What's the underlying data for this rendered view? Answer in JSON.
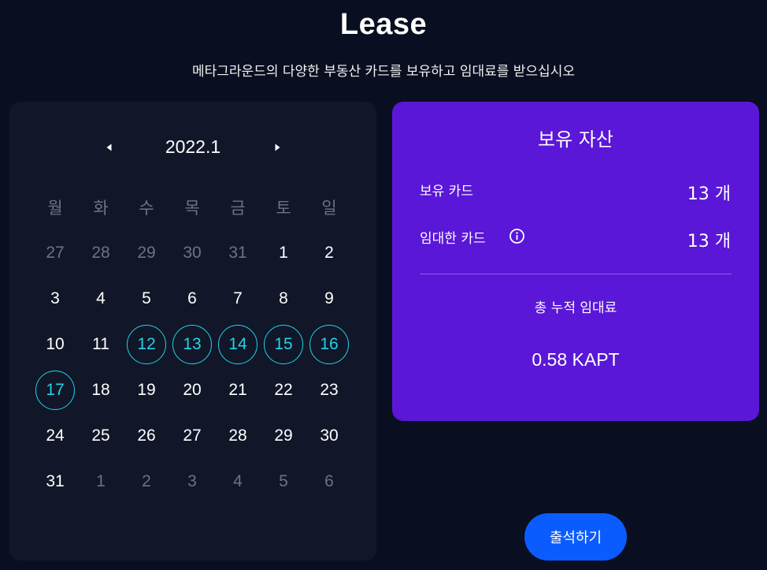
{
  "header": {
    "title": "Lease",
    "subtitle": "메타그라운드의 다양한 부동산 카드를 보유하고 임대료를 받으십시오"
  },
  "calendar": {
    "month_label": "2022.1",
    "prev_icon": "caret-left-icon",
    "next_icon": "caret-right-icon",
    "weekdays": [
      "월",
      "화",
      "수",
      "목",
      "금",
      "토",
      "일"
    ],
    "days": [
      {
        "label": "27",
        "state": "muted"
      },
      {
        "label": "28",
        "state": "muted"
      },
      {
        "label": "29",
        "state": "muted"
      },
      {
        "label": "30",
        "state": "muted"
      },
      {
        "label": "31",
        "state": "muted"
      },
      {
        "label": "1",
        "state": "normal"
      },
      {
        "label": "2",
        "state": "normal"
      },
      {
        "label": "3",
        "state": "normal"
      },
      {
        "label": "4",
        "state": "normal"
      },
      {
        "label": "5",
        "state": "normal"
      },
      {
        "label": "6",
        "state": "normal"
      },
      {
        "label": "7",
        "state": "normal"
      },
      {
        "label": "8",
        "state": "normal"
      },
      {
        "label": "9",
        "state": "normal"
      },
      {
        "label": "10",
        "state": "normal"
      },
      {
        "label": "11",
        "state": "normal"
      },
      {
        "label": "12",
        "state": "attended"
      },
      {
        "label": "13",
        "state": "attended"
      },
      {
        "label": "14",
        "state": "attended"
      },
      {
        "label": "15",
        "state": "attended"
      },
      {
        "label": "16",
        "state": "attended"
      },
      {
        "label": "17",
        "state": "attended"
      },
      {
        "label": "18",
        "state": "normal"
      },
      {
        "label": "19",
        "state": "normal"
      },
      {
        "label": "20",
        "state": "normal"
      },
      {
        "label": "21",
        "state": "normal"
      },
      {
        "label": "22",
        "state": "normal"
      },
      {
        "label": "23",
        "state": "normal"
      },
      {
        "label": "24",
        "state": "normal"
      },
      {
        "label": "25",
        "state": "normal"
      },
      {
        "label": "26",
        "state": "normal"
      },
      {
        "label": "27",
        "state": "normal"
      },
      {
        "label": "28",
        "state": "normal"
      },
      {
        "label": "29",
        "state": "normal"
      },
      {
        "label": "30",
        "state": "normal"
      },
      {
        "label": "31",
        "state": "normal"
      },
      {
        "label": "1",
        "state": "muted"
      },
      {
        "label": "2",
        "state": "muted"
      },
      {
        "label": "3",
        "state": "muted"
      },
      {
        "label": "4",
        "state": "muted"
      },
      {
        "label": "5",
        "state": "muted"
      },
      {
        "label": "6",
        "state": "muted"
      }
    ]
  },
  "assets": {
    "title": "보유 자산",
    "owned_cards_label": "보유 카드",
    "owned_cards_value": "13 개",
    "leased_cards_label": "임대한 카드",
    "leased_cards_value": "13 개",
    "info_icon": "info-icon",
    "total_rent_label": "총 누적 임대료",
    "total_rent_value": "0.58 KAPT"
  },
  "attend_button": {
    "label": "출석하기"
  },
  "colors": {
    "background": "#0a0e21",
    "calendar_panel": "#111629",
    "assets_panel": "#5a17d7",
    "attended_accent": "#22d3e6",
    "button": "#0b5cff",
    "muted_text": "#6d7286"
  }
}
